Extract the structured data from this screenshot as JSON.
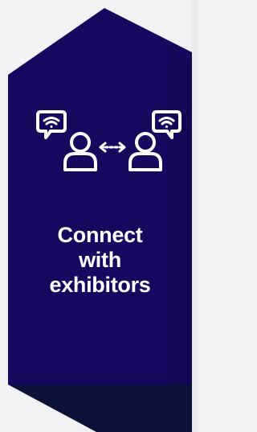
{
  "tile": {
    "label_lines": [
      "Connect",
      "with",
      "exhibitors"
    ],
    "icon": "connect-people-icon",
    "colors": {
      "tile_fill": "#17085f",
      "tile_shadow": "#0c1138",
      "tile_border": "#2a1f6e",
      "background": "#f1f2f3",
      "icon_stroke": "#ffffff",
      "label_color": "#ffffff"
    }
  }
}
